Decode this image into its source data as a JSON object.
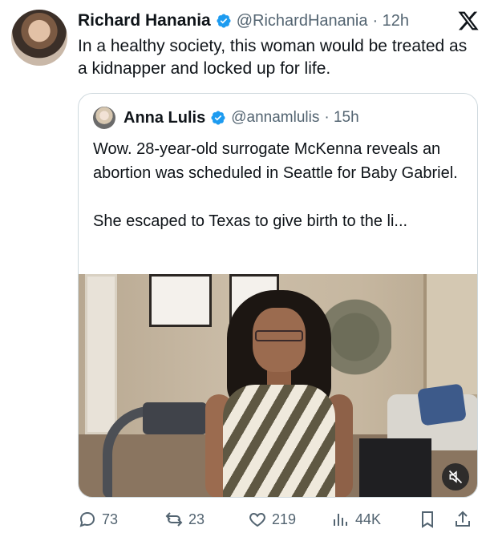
{
  "tweet": {
    "author_name": "Richard Hanania",
    "author_handle": "@RichardHanania",
    "time": "· 12h",
    "text": "In a healthy society, this woman would be treated as a kidnapper and locked up for life."
  },
  "quote": {
    "author_name": "Anna Lulis",
    "author_handle": "@annamlulis",
    "time": "· 15h",
    "text": "Wow. 28-year-old surrogate McKenna reveals an abortion was scheduled in Seattle for Baby Gabriel.\n\nShe escaped to Texas to give birth to the li..."
  },
  "actions": {
    "replies": "73",
    "reposts": "23",
    "likes": "219",
    "views": "44K"
  },
  "icons": [
    "x-logo-icon",
    "verified-badge-icon",
    "reply-icon",
    "repost-icon",
    "like-icon",
    "views-icon",
    "bookmark-icon",
    "share-icon",
    "mute-icon"
  ],
  "colors": {
    "verified": "#1d9bf0",
    "secondary_text": "#536471",
    "border": "#cfd9de"
  }
}
